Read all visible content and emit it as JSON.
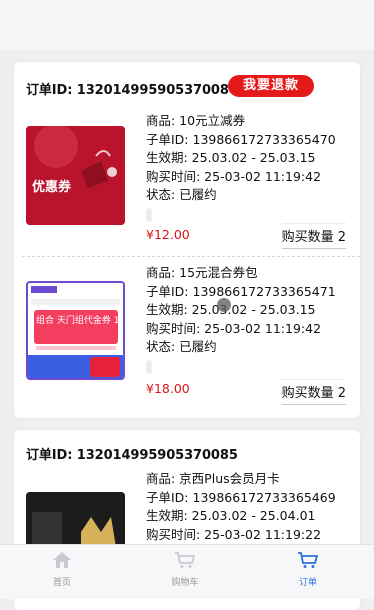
{
  "orders": [
    {
      "order_id": "订单ID: 132014995905370086",
      "refund_label": "我要退款",
      "items": [
        {
          "thumb_text": "优惠券",
          "lines": [
            "商品: 10元立减券",
            "子单ID: 139866172733365470",
            "生效期: 25.03.02 - 25.03.15",
            "购买时间: 25-03-02 11:19:42",
            "状态: 已履约"
          ],
          "price": "¥12.00",
          "qty": "购买数量 2"
        },
        {
          "thumb_text": "组合 天门组代金券 15 元",
          "lines": [
            "商品: 15元混合券包",
            "子单ID: 139866172733365471",
            "生效期: 25.03.02 - 25.03.15",
            "购买时间: 25-03-02 11:19:42",
            "状态: 已履约"
          ],
          "price": "¥18.00",
          "qty": "购买数量 2"
        }
      ]
    },
    {
      "order_id": "订单ID: 132014995905370085",
      "items": [
        {
          "lines": [
            "商品: 京西Plus会员月卡",
            "子单ID: 139866172733365469",
            "生效期: 25.03.02 - 25.04.01",
            "购买时间: 25-03-02 11:19:22"
          ]
        }
      ]
    }
  ],
  "nav": {
    "items": [
      {
        "label": "首页",
        "icon": "home-icon"
      },
      {
        "label": "购物车",
        "icon": "cart-icon"
      },
      {
        "label": "订单",
        "icon": "order-icon"
      }
    ],
    "active_color": "#2f6fe0"
  },
  "colors": {
    "accent": "#e41a1a",
    "price": "#d9171b"
  }
}
